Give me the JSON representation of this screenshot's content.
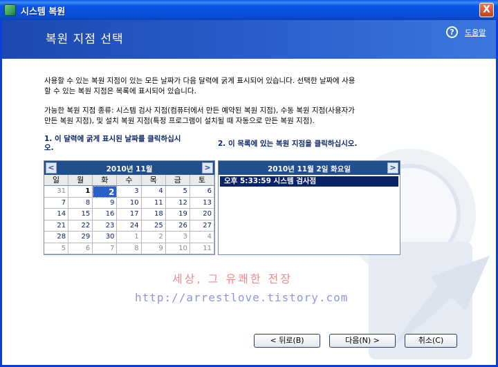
{
  "window": {
    "title": "시스템 복원",
    "close_label": "X"
  },
  "header": {
    "heading": "복원 지점 선택",
    "help_label": "도움말"
  },
  "intro": {
    "line1": "사용할 수 있는 복원 지점이 있는 모든 날짜가 다음 달력에 굵게 표시되어 있습니다. 선택한 날짜에 사용",
    "line2": "할 수 있는 복원 지점은 목록에 표시되어 있습니다.",
    "types1": "가능한 복원 지점 종류: 시스템 검사 지점(컴퓨터에서 만든 예약된 복원 지점), 수동 복원 지점(사용자가",
    "types2": "만든 복원 지점), 및 설치 복원 지점(특정 프로그램이 설치될 때 자동으로 만든 복원 지점)."
  },
  "step1": {
    "line1": "1. 이 달력에 굵게 표시된 날짜를 클릭하십시",
    "line2": "오."
  },
  "step2": {
    "label": "2. 이 목록에 있는 복원 지점을 클릭하십시오."
  },
  "calendar": {
    "prev": "<",
    "next": ">",
    "month_title": "2010년 11월",
    "weekdays": [
      "일",
      "월",
      "화",
      "수",
      "목",
      "금",
      "토"
    ],
    "days": [
      {
        "d": "31",
        "t": "other"
      },
      {
        "d": "1",
        "t": "bold"
      },
      {
        "d": "2",
        "t": "sel"
      },
      {
        "d": "3",
        "t": ""
      },
      {
        "d": "4",
        "t": ""
      },
      {
        "d": "5",
        "t": ""
      },
      {
        "d": "6",
        "t": ""
      },
      {
        "d": "7",
        "t": ""
      },
      {
        "d": "8",
        "t": ""
      },
      {
        "d": "9",
        "t": ""
      },
      {
        "d": "10",
        "t": ""
      },
      {
        "d": "11",
        "t": ""
      },
      {
        "d": "12",
        "t": ""
      },
      {
        "d": "13",
        "t": ""
      },
      {
        "d": "14",
        "t": ""
      },
      {
        "d": "15",
        "t": ""
      },
      {
        "d": "16",
        "t": ""
      },
      {
        "d": "17",
        "t": ""
      },
      {
        "d": "18",
        "t": ""
      },
      {
        "d": "19",
        "t": ""
      },
      {
        "d": "20",
        "t": ""
      },
      {
        "d": "21",
        "t": ""
      },
      {
        "d": "22",
        "t": ""
      },
      {
        "d": "23",
        "t": ""
      },
      {
        "d": "24",
        "t": ""
      },
      {
        "d": "25",
        "t": ""
      },
      {
        "d": "26",
        "t": ""
      },
      {
        "d": "27",
        "t": ""
      },
      {
        "d": "28",
        "t": ""
      },
      {
        "d": "29",
        "t": ""
      },
      {
        "d": "30",
        "t": ""
      },
      {
        "d": "1",
        "t": "other"
      },
      {
        "d": "2",
        "t": "other"
      },
      {
        "d": "3",
        "t": "other"
      },
      {
        "d": "4",
        "t": "other"
      },
      {
        "d": "5",
        "t": "other"
      },
      {
        "d": "6",
        "t": "other"
      },
      {
        "d": "7",
        "t": "other"
      },
      {
        "d": "8",
        "t": "other"
      },
      {
        "d": "9",
        "t": "other"
      },
      {
        "d": "10",
        "t": "other"
      },
      {
        "d": "11",
        "t": "other"
      }
    ]
  },
  "restore_list": {
    "prev": "<",
    "next": ">",
    "date_title": "2010년 11월 2일 화요일",
    "items": [
      "오후 5:33:59  시스템 검사점"
    ]
  },
  "watermark": {
    "line1": "세상, 그 유쾌한 전장",
    "line2": "http://arrestlove.tistory.com"
  },
  "buttons": {
    "back": "< 뒤로(B)",
    "next": "다음(N) >",
    "cancel": "취소(C)"
  },
  "colors": {
    "header": "#2a5fcc",
    "selection": "#0a246a",
    "title_bar": "#0a4fd6"
  }
}
